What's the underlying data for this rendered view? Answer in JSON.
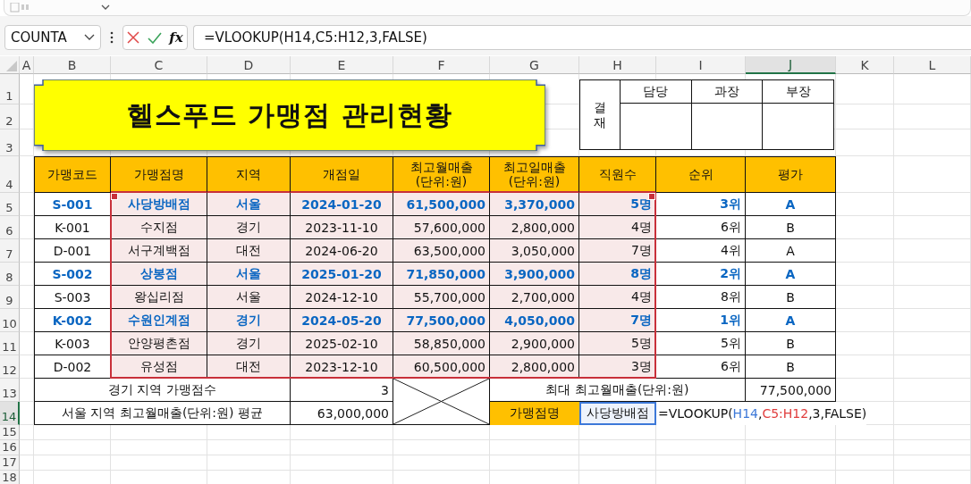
{
  "formula_bar": {
    "name_box": "COUNTA",
    "fx": "fx",
    "formula": "=VLOOKUP(H14,C5:H12,3,FALSE)"
  },
  "columns": [
    {
      "label": "A",
      "selected": false
    },
    {
      "label": "B",
      "selected": false
    },
    {
      "label": "C",
      "selected": false
    },
    {
      "label": "D",
      "selected": false
    },
    {
      "label": "E",
      "selected": false
    },
    {
      "label": "F",
      "selected": false
    },
    {
      "label": "G",
      "selected": false
    },
    {
      "label": "H",
      "selected": false
    },
    {
      "label": "I",
      "selected": false
    },
    {
      "label": "J",
      "selected": true
    },
    {
      "label": "K",
      "selected": false
    },
    {
      "label": "L",
      "selected": false
    }
  ],
  "row_numbers": [
    {
      "label": "1",
      "selected": false
    },
    {
      "label": "2",
      "selected": false
    },
    {
      "label": "3",
      "selected": false
    },
    {
      "label": "4",
      "selected": false
    },
    {
      "label": "5",
      "selected": false
    },
    {
      "label": "6",
      "selected": false
    },
    {
      "label": "7",
      "selected": false
    },
    {
      "label": "8",
      "selected": false
    },
    {
      "label": "9",
      "selected": false
    },
    {
      "label": "10",
      "selected": false
    },
    {
      "label": "11",
      "selected": false
    },
    {
      "label": "12",
      "selected": false
    },
    {
      "label": "13",
      "selected": false
    },
    {
      "label": "14",
      "selected": true
    },
    {
      "label": "15",
      "selected": false
    },
    {
      "label": "16",
      "selected": false
    },
    {
      "label": "17",
      "selected": false
    },
    {
      "label": "18",
      "selected": false
    }
  ],
  "title": "헬스푸드 가맹점 관리현황",
  "approval": {
    "label": "결재",
    "headers": [
      "담당",
      "과장",
      "부장"
    ]
  },
  "table": {
    "headers": [
      {
        "lines": [
          "가맹코드"
        ],
        "referenced": false
      },
      {
        "lines": [
          "가맹점명"
        ],
        "referenced": true
      },
      {
        "lines": [
          "지역"
        ],
        "referenced": true
      },
      {
        "lines": [
          "개점일"
        ],
        "referenced": true
      },
      {
        "lines": [
          "최고월매출",
          "(단위:원)"
        ],
        "referenced": true
      },
      {
        "lines": [
          "최고일매출",
          "(단위:원)"
        ],
        "referenced": true
      },
      {
        "lines": [
          "직원수"
        ],
        "referenced": true
      },
      {
        "lines": [
          "순위"
        ],
        "referenced": false
      },
      {
        "lines": [
          "평가"
        ],
        "referenced": false
      }
    ],
    "rows": [
      {
        "cells": [
          "S-001",
          "사당방배점",
          "서울",
          "2024-01-20",
          "61,500,000",
          "3,370,000",
          "5명",
          "3위",
          "A"
        ],
        "highlighted": true
      },
      {
        "cells": [
          "K-001",
          "수지점",
          "경기",
          "2023-11-10",
          "57,600,000",
          "2,800,000",
          "4명",
          "6위",
          "B"
        ],
        "highlighted": false
      },
      {
        "cells": [
          "D-001",
          "서구계백점",
          "대전",
          "2024-06-20",
          "63,500,000",
          "3,050,000",
          "7명",
          "4위",
          "A"
        ],
        "highlighted": false
      },
      {
        "cells": [
          "S-002",
          "상봉점",
          "서울",
          "2025-01-20",
          "71,850,000",
          "3,900,000",
          "8명",
          "2위",
          "A"
        ],
        "highlighted": true
      },
      {
        "cells": [
          "S-003",
          "왕십리점",
          "서울",
          "2024-12-10",
          "55,700,000",
          "2,700,000",
          "4명",
          "8위",
          "B"
        ],
        "highlighted": false
      },
      {
        "cells": [
          "K-002",
          "수원인계점",
          "경기",
          "2024-05-20",
          "77,500,000",
          "4,050,000",
          "7명",
          "1위",
          "A"
        ],
        "highlighted": true
      },
      {
        "cells": [
          "K-003",
          "안양평촌점",
          "경기",
          "2025-02-10",
          "58,850,000",
          "2,900,000",
          "5명",
          "5위",
          "B"
        ],
        "highlighted": false
      },
      {
        "cells": [
          "D-002",
          "유성점",
          "대전",
          "2023-12-10",
          "60,500,000",
          "2,800,000",
          "3명",
          "6위",
          "B"
        ],
        "highlighted": false
      }
    ]
  },
  "summary": {
    "gyeonggi_label": "경기 지역 가맹점수",
    "gyeonggi_value": "3",
    "max_label": "최대 최고월매출(단위:원)",
    "max_value": "77,500,000",
    "seoul_label": "서울 지역 최고월매출(단위:원) 평균",
    "seoul_value": "63,000,000",
    "lookup_label": "가맹점명",
    "lookup_value": "사당방배점",
    "editing_formula": [
      {
        "text": "=VLOOKUP("
      },
      {
        "text": "H14",
        "color": "#3c78d8"
      },
      {
        "text": ","
      },
      {
        "text": "C5:H12",
        "color": "#e03c3c"
      },
      {
        "text": ",3,FALSE)"
      }
    ]
  }
}
